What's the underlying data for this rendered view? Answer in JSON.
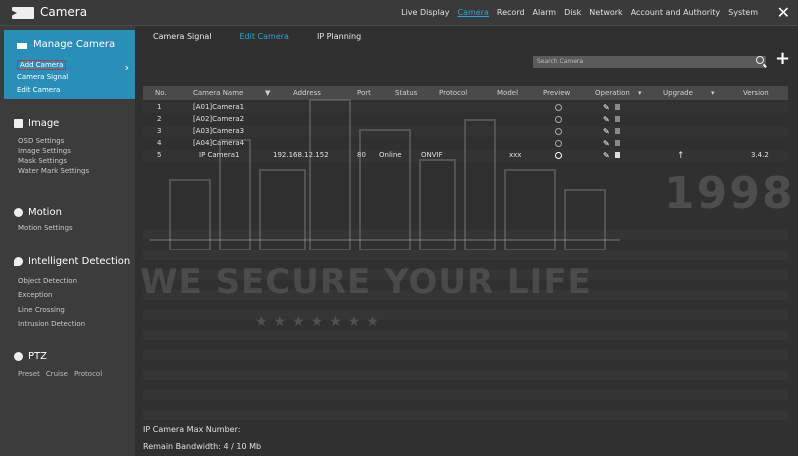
{
  "app": {
    "title": "Camera"
  },
  "topnav": {
    "items": [
      "Live Display",
      "Camera",
      "Record",
      "Alarm",
      "Disk",
      "Network",
      "Account and Authority",
      "System"
    ],
    "active": "Camera"
  },
  "sidebar": {
    "manage_camera": {
      "title": "Manage Camera",
      "items": [
        "Add Camera",
        "Camera Signal",
        "Edit Camera"
      ]
    },
    "image": {
      "title": "Image",
      "items": [
        "OSD Settings",
        "Image Settings",
        "Mask Settings",
        "Water Mark Settings"
      ]
    },
    "motion": {
      "title": "Motion",
      "items": [
        "Motion Settings"
      ]
    },
    "intelligent": {
      "title": "Intelligent Detection",
      "items": [
        "Object Detection",
        "Exception",
        "Line Crossing",
        "Intrusion Detection"
      ]
    },
    "ptz": {
      "title": "PTZ",
      "items": [
        "Preset",
        "Cruise",
        "Protocol"
      ]
    }
  },
  "tabs": [
    "Camera Signal",
    "Edit Camera",
    "IP Planning"
  ],
  "search": {
    "placeholder": "Search Camera"
  },
  "table": {
    "headers": [
      "No.",
      "Camera Name",
      "Address",
      "Port",
      "Status",
      "Protocol",
      "Model",
      "Preview",
      "Operation",
      "Upgrade",
      "Version"
    ],
    "rows": [
      {
        "no": "1",
        "name": "[A01]Camera1"
      },
      {
        "no": "2",
        "name": "[A02]Camera2"
      },
      {
        "no": "3",
        "name": "[A03]Camera3"
      },
      {
        "no": "4",
        "name": "[A04]Camera4"
      },
      {
        "no": "5",
        "name": "IP Camera1",
        "address": "192.168.12.152",
        "port": "80",
        "status": "Online",
        "protocol": "ONVIF",
        "model": "xxx",
        "version": "3.4.2"
      }
    ]
  },
  "footer": {
    "max_label": "IP Camera Max Number:",
    "bandwidth_label": "Remain Bandwidth:",
    "bandwidth_value": "4 / 10 Mb"
  },
  "watermark": {
    "year": "1998",
    "slogan": "WE SECURE YOUR LIFE",
    "stars": "★★★★★★★"
  },
  "colors": {
    "accent": "#2a8fb8",
    "active_link": "#2da3d4"
  }
}
